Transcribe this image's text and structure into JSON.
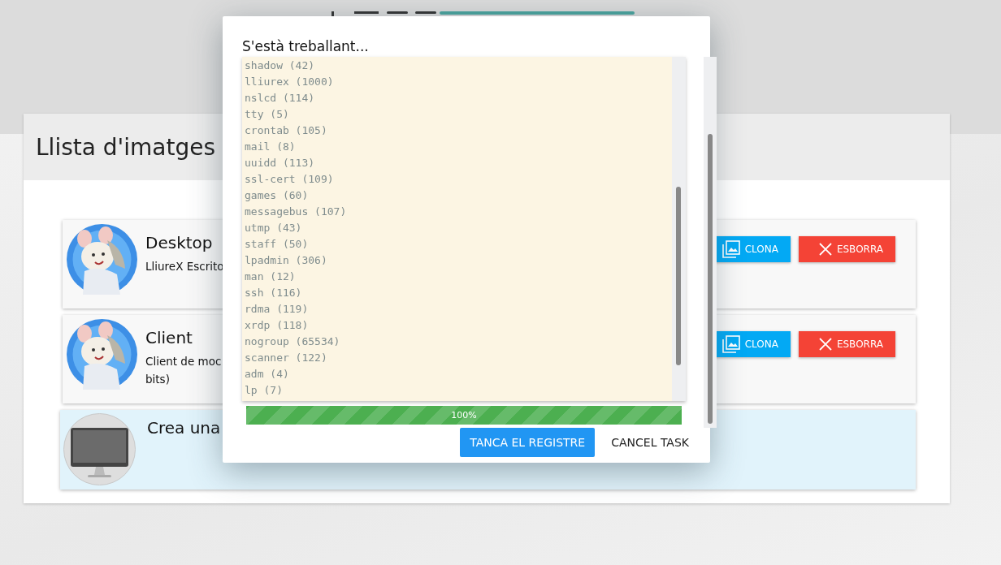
{
  "page": {
    "title": "Llista d'imatges"
  },
  "images": [
    {
      "kind": "image",
      "name": "Desktop",
      "description": [
        "LliureX Escrito"
      ],
      "buttons": [
        {
          "kind": "clone",
          "label": "CLONA"
        },
        {
          "kind": "delete",
          "label": "ESBORRA"
        }
      ]
    },
    {
      "kind": "image",
      "name": "Client",
      "description": [
        "Client de moc",
        "bits)"
      ],
      "buttons": [
        {
          "kind": "clone",
          "label": "CLONA"
        },
        {
          "kind": "delete",
          "label": "ESBORRA"
        }
      ]
    },
    {
      "kind": "create",
      "name": "Crea una"
    }
  ],
  "dialog": {
    "title": "S'està treballant...",
    "log": [
      "shadow (42)",
      "lliurex (1000)",
      "nslcd (114)",
      "tty (5)",
      "crontab (105)",
      "mail (8)",
      "uuidd (113)",
      "ssl-cert (109)",
      "games (60)",
      "messagebus (107)",
      "utmp (43)",
      "staff (50)",
      "lpadmin (306)",
      "man (12)",
      "ssh (116)",
      "rdma (119)",
      "xrdp (118)",
      "nogroup (65534)",
      "scanner (122)",
      "adm (4)",
      "lp (7)"
    ],
    "progress": {
      "level": 1,
      "label": "100%"
    },
    "buttons": [
      {
        "kind": "primary",
        "label": "TANCA EL REGISTRE"
      },
      {
        "kind": "text",
        "label": "CANCEL TASK"
      }
    ]
  }
}
